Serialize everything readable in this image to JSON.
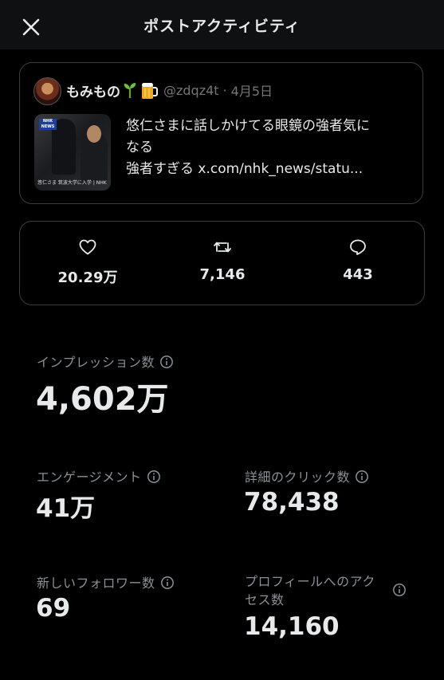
{
  "header": {
    "title": "ポストアクティビティ"
  },
  "post": {
    "author_name": "もみもの",
    "handle": "@zdqz4t",
    "separator": "·",
    "date": "4月5日",
    "text_line1": "悠仁さまに話しかけてる眼鏡の強者気に",
    "text_line2": "なる",
    "text_line3": "強者すぎる  x.com/nhk_news/statu...",
    "thumbnail": {
      "logo": "NHK NEWS",
      "caption": "悠仁さま 筑波大学に入学 | NHK"
    }
  },
  "engagement": {
    "likes": "20.29万",
    "reposts": "7,146",
    "replies": "443"
  },
  "metrics": {
    "impressions": {
      "label": "インプレッション数",
      "value": "4,602万"
    },
    "engagements": {
      "label": "エンゲージメント",
      "value": "41万"
    },
    "detail_clicks": {
      "label": "詳細のクリック数",
      "value": "78,438"
    },
    "new_followers": {
      "label": "新しいフォロワー数",
      "value": "69"
    },
    "profile_visits": {
      "label_line1": "プロフィールへのアク",
      "label_line2": "セス数",
      "value": "14,160"
    }
  },
  "icons": {
    "close": "close-icon",
    "like": "heart-icon",
    "repost": "repost-icon",
    "reply": "reply-bubble-icon",
    "info": "info-icon"
  },
  "colors": {
    "background": "#000000",
    "text": "#e7e9ea",
    "muted": "#71767b",
    "border": "#3a3d40"
  }
}
